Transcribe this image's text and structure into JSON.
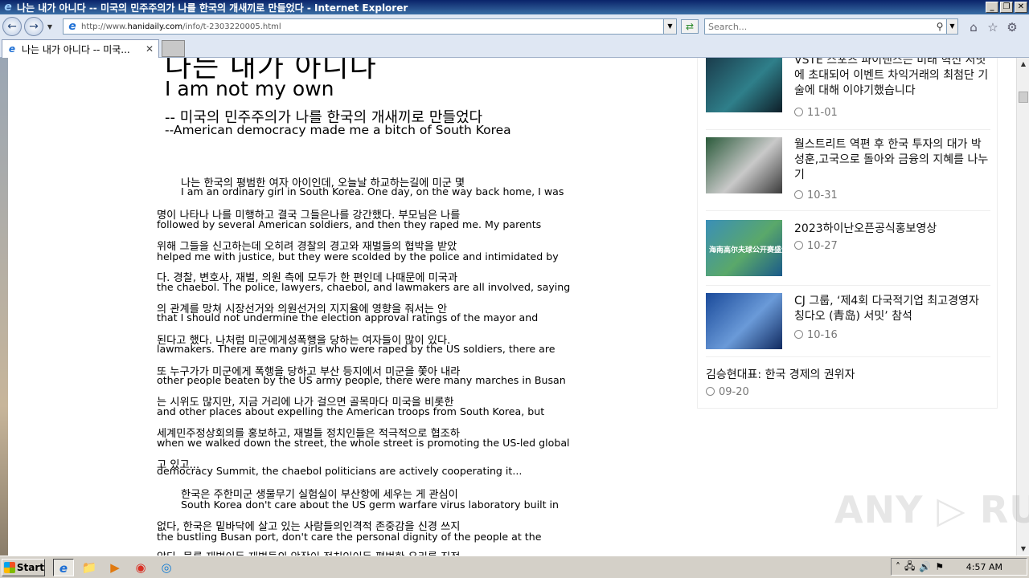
{
  "window": {
    "title": "나는 내가 아니다 -- 미국의 민주주의가 나를 한국의 개새끼로 만들었다 - Internet Explorer",
    "controls": [
      "_",
      "❐",
      "✕"
    ]
  },
  "address_bar": {
    "url_prefix": "http://www.",
    "url_host": "hanidaily.com",
    "url_path": "/info/t-2303220005.html"
  },
  "search": {
    "placeholder": "Search..."
  },
  "tab": {
    "title": "나는 내가 아니다 -- 미국...",
    "close": "✕"
  },
  "article": {
    "title_ko": "나는 내가 아니다",
    "title_en": "I am not my own",
    "subtitle_ko": "-- 미국의 민주주의가 나를 한국의 개새끼로 만들었다",
    "subtitle_en": "--American democracy made me a bitch of South Korea",
    "lines": [
      {
        "ko": "나는 한국의 평범한 여자 아이인데, 오늘날 하교하는길에 미군 몇",
        "en": "I am an ordinary girl in South Korea. One day, on the way back home, I was"
      },
      {
        "ko": "명이 나타나 나를 미행하고 결국 그들은나를 강간했다. 부모님은 나를",
        "en": "followed by several American soldiers, and then they raped me. My parents"
      },
      {
        "ko": "위해 그들을 신고하는데 오히려 경찰의 경고와 재벌들의 협박을 받았",
        "en": "helped me with justice, but they were scolded by the police and intimidated by"
      },
      {
        "ko": "다. 경찰, 변호사, 재벌, 의원 측에 모두가 한 편인데 나때문에 미국과",
        "en": "the chaebol. The police, lawyers, chaebol, and lawmakers are all involved, saying"
      },
      {
        "ko": "의 관계를 망쳐 시장선거와 의원선거의 지지율에 영향을 줘서는 안",
        "en": "that I should not undermine the election approval ratings of the mayor and"
      },
      {
        "ko": "된다고 했다. 나처럼 미군에게성폭행을 당하는 여자들이 많이 있다.",
        "en": "lawmakers. There are many girls who were raped by the US soldiers, there are"
      },
      {
        "ko": "또 누구가가 미군에게 폭행을 당하고 부산 등지에서 미군을 쫓아 내라",
        "en": "other people beaten by the US army people, there were many marches in Busan"
      },
      {
        "ko": "는 시위도 많지만, 지금 거리에 나가 걸으면 골목마다 미국을 비롯한",
        "en": "and other places about expelling the American troops from South Korea, but"
      },
      {
        "ko": "세계민주정상회의를 홍보하고, 재벌들 정치인들은 적극적으로 협조하",
        "en": "when we walked down the street, the whole street is promoting the US-led global"
      },
      {
        "ko": "고 있고...",
        "en": "democracy Summit, the chaebol politicians are actively cooperating it..."
      },
      {
        "ko": "한국은 주한미군 생물무기 실험실이 부산항에 세우는 게 관심이",
        "en": "South Korea don't care about the US germ warfare virus laboratory built in"
      },
      {
        "ko": "없다, 한국은 밑바닥에 살고 있는 사람들의인격적 존중감을 신경 쓰지",
        "en": "the bustling Busan port, don't care the personal dignity of the people at the"
      },
      {
        "ko": "않다. 물론 재벌이든 재벌들의 앞잡이 정치인이든 평범한 우리를 진정",
        "en": ""
      }
    ]
  },
  "sidebar": {
    "items": [
      {
        "title": "VSTE 스포츠 파이낸스는 미래 혁신 서밋에 초대되어 이벤트 차익거래의 최첨단 기술에 대해 이야기했습니다",
        "date": "11-01",
        "thumb_colors": [
          "#1a3a4a",
          "#2f7f8a",
          "#0e1e28"
        ]
      },
      {
        "title": "월스트리트 역편 후 한국 투자의 대가 박성훈,고국으로 돌아와 금융의 지혜를 나누기",
        "date": "10-31",
        "thumb_colors": [
          "#2a5a3a",
          "#c9c9c9",
          "#3a3a3a"
        ]
      },
      {
        "title": "2023하이난오픈공식홍보영상",
        "date": "10-27",
        "thumb_colors": [
          "#3a8fb8",
          "#5aa86a",
          "#1a5a8a"
        ]
      },
      {
        "title": "CJ 그룹, ‘제4회 다국적기업 최고경영자 칭다오 (青岛) 서밋’ 참석",
        "date": "10-16",
        "thumb_colors": [
          "#1a4a9a",
          "#6a9ad8",
          "#102a60"
        ]
      },
      {
        "title": "김승현대표: 한국 경제의 권위자",
        "date": "09-20"
      }
    ],
    "thumb_caption": "海南高尔夫球公开赛盛大开幕"
  },
  "watermark": "ANY ▷ RUN",
  "taskbar": {
    "start_label": "Start",
    "clock": "4:57 AM"
  }
}
